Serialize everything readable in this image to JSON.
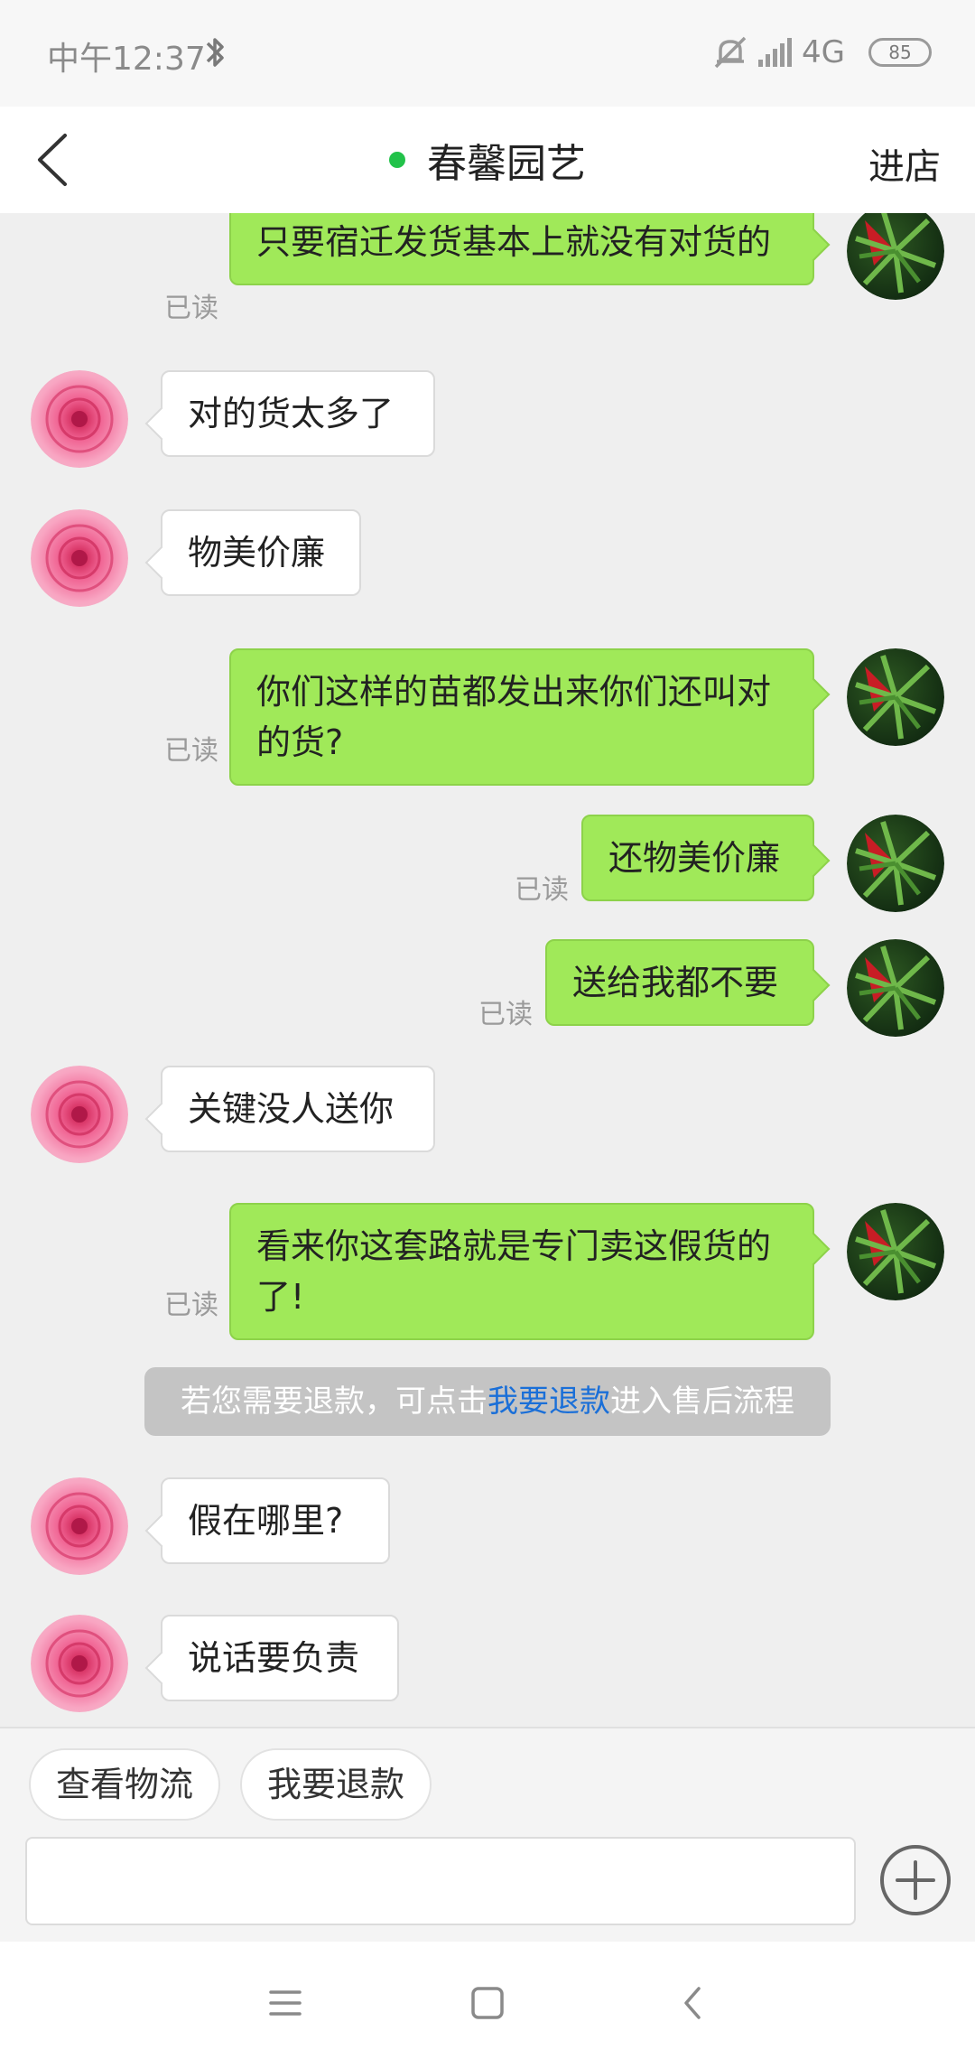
{
  "status_bar": {
    "time": "中午12:37",
    "network": "4G",
    "battery": "85",
    "icons": [
      "bluetooth-icon",
      "mute-icon",
      "signal-icon",
      "battery-icon"
    ]
  },
  "header": {
    "title": "春馨园艺",
    "right_action": "进店",
    "online_color": "#22c24a",
    "back_icon": "chevron-left-icon"
  },
  "messages": [
    {
      "side": "right",
      "text": "只要宿迁发货基本上就没有对货的",
      "read": "已读"
    },
    {
      "side": "left",
      "text": "对的货太多了"
    },
    {
      "side": "left",
      "text": "物美价廉"
    },
    {
      "side": "right",
      "text": "你们这样的苗都发出来你们还叫对的货?",
      "read": "已读"
    },
    {
      "side": "right",
      "text": "还物美价廉",
      "read": "已读"
    },
    {
      "side": "right",
      "text": "送给我都不要",
      "read": "已读"
    },
    {
      "side": "left",
      "text": "关键没人送你"
    },
    {
      "side": "right",
      "text": "看来你这套路就是专门卖这假货的了!",
      "read": "已读"
    },
    {
      "side": "left",
      "text": "假在哪里?"
    },
    {
      "side": "left",
      "text": "说话要负责"
    }
  ],
  "system_notice": {
    "prefix": "若您需要退款，可点击",
    "link": "我要退款",
    "suffix": "进入售后流程"
  },
  "quick_actions": [
    {
      "label": "查看物流"
    },
    {
      "label": "我要退款"
    }
  ],
  "input": {
    "value": "",
    "placeholder": ""
  },
  "colors": {
    "sent_bubble": "#a0e959",
    "received_bubble": "#ffffff",
    "link": "#1a6fd8",
    "background": "#efefef"
  }
}
